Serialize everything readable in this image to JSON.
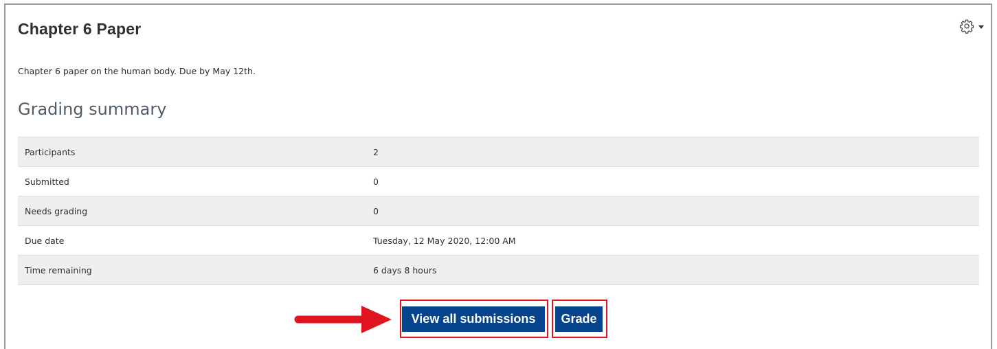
{
  "assignment": {
    "title": "Chapter 6 Paper",
    "description": "Chapter 6 paper on the human body. Due by May 12th."
  },
  "grading_summary": {
    "heading": "Grading summary",
    "rows": [
      {
        "label": "Participants",
        "value": "2"
      },
      {
        "label": "Submitted",
        "value": "0"
      },
      {
        "label": "Needs grading",
        "value": "0"
      },
      {
        "label": "Due date",
        "value": "Tuesday, 12 May 2020, 12:00 AM"
      },
      {
        "label": "Time remaining",
        "value": "6 days 8 hours"
      }
    ]
  },
  "actions": {
    "view_all_label": "View all submissions",
    "grade_label": "Grade"
  },
  "icons": {
    "settings": "gear-icon",
    "settings_menu": "caret-down-icon",
    "annotation": "red-arrow-icon"
  },
  "colors": {
    "button_bg": "#06458e",
    "highlight": "#e0141e",
    "row_stripe": "#efefef"
  }
}
